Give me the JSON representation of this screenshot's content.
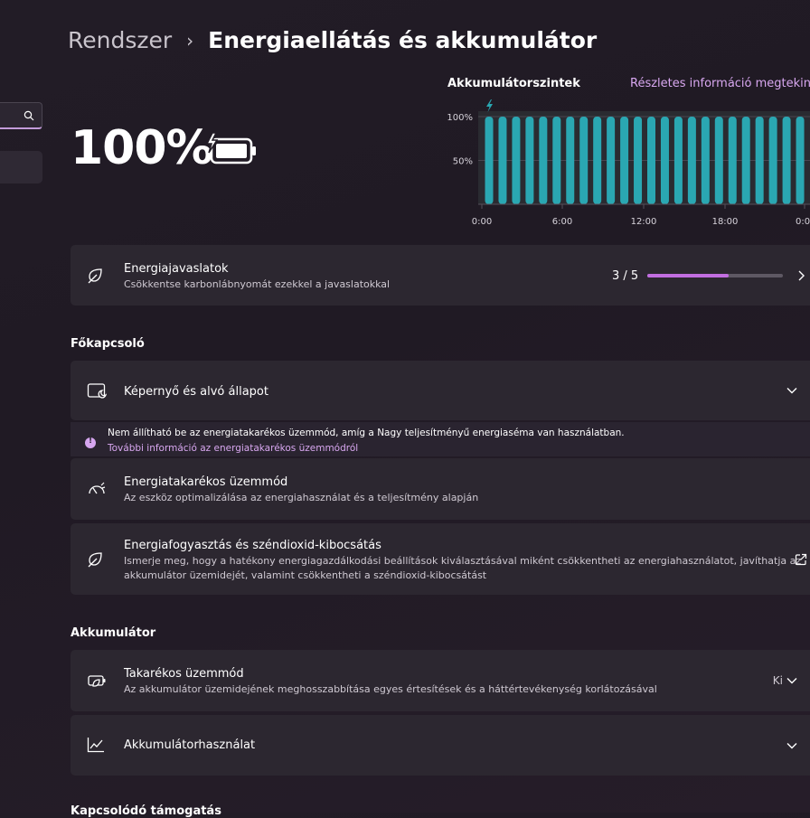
{
  "breadcrumb": {
    "parent": "Rendszer",
    "separator": "›",
    "current": "Energiaellátás és akkumulátor"
  },
  "battery": {
    "percent": "100%",
    "charging": true
  },
  "chart_data": {
    "type": "bar",
    "title": "Akkumulátorszintek",
    "link": "Részletes információ megtekinté",
    "y_ticks": [
      "100%",
      "50%"
    ],
    "x_ticks": [
      "0:00",
      "6:00",
      "12:00",
      "18:00",
      "0:0"
    ],
    "ylim": [
      0,
      100
    ],
    "bar_count": 24,
    "values": [
      100,
      100,
      100,
      100,
      100,
      100,
      100,
      100,
      100,
      100,
      100,
      100,
      100,
      100,
      100,
      100,
      100,
      100,
      100,
      100,
      100,
      100,
      100,
      100
    ],
    "charging_marker": "lightning-icon",
    "color": "#2aa7b2"
  },
  "recommendations": {
    "title": "Energiajavaslatok",
    "subtitle": "Csökkentse karbonlábnyomát ezekkel a javaslatokkal",
    "progress_label": "3 / 5",
    "progress_value": 0.6
  },
  "section_power": {
    "heading": "Főkapcsoló"
  },
  "screen_sleep": {
    "title": "Képernyő és alvó állapot"
  },
  "info": {
    "text": "Nem állítható be az energiatakarékos üzemmód, amíg a Nagy teljesítményű energiaséma van használatban.",
    "link": "További információ az energiatakarékos üzemmódról"
  },
  "energy_saver": {
    "title": "Energiatakarékos üzemmód",
    "subtitle": "Az eszköz optimalizálása az energiahasználat és a teljesítmény alapján"
  },
  "consumption": {
    "title": "Energiafogyasztás és széndioxid-kibocsátás",
    "subtitle_line1": "Ismerje meg, hogy a hatékony energiagazdálkodási beállítások kiválasztásával miként csökkentheti az energiahasználatot, javíthatja az",
    "subtitle_line2": "akkumulátor üzemidejét, valamint csökkentheti a széndioxid-kibocsátást"
  },
  "section_battery": {
    "heading": "Akkumulátor"
  },
  "battery_saver": {
    "title": "Takarékos üzemmód",
    "subtitle": "Az akkumulátor üzemidejének meghosszabbítása egyes értesítések és a háttértevékenység korlátozásával",
    "state": "Ki"
  },
  "battery_usage": {
    "title": "Akkumulátorhasználat"
  },
  "bottom_section": {
    "heading": "Kapcsolódó támogatás"
  },
  "colors": {
    "accent": "#c26ee0",
    "link": "#d8a7f0",
    "chart": "#2aa7b2"
  }
}
